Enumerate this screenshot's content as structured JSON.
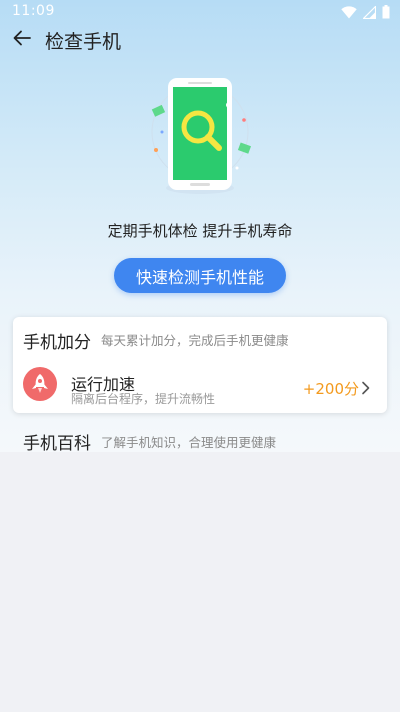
{
  "status_bar": {
    "time": "11:09",
    "icons": [
      "wifi-icon",
      "signal-icon",
      "battery-icon"
    ]
  },
  "app_bar": {
    "title": "检查手机",
    "back_icon": "arrow-left-icon"
  },
  "hero": {
    "tagline": "定期手机体检 提升手机寿命",
    "scan_button_label": "快速检测手机性能",
    "illustration_icon": "phone-magnifier-icon"
  },
  "score_card": {
    "title": "手机加分",
    "subtitle": "每天累计加分，完成后手机更健康",
    "tasks": [
      {
        "title": "运行加速",
        "subtitle": "隔离后台程序，提升流畅性",
        "reward": "+200分",
        "icon": "rocket-icon"
      }
    ]
  },
  "knowledge": {
    "title": "手机百科",
    "subtitle": "了解手机知识，合理使用更健康"
  },
  "colors": {
    "primary_button": "#3f86f0",
    "reward_text": "#f39a1e",
    "task_icon_bg": "#f06a6a",
    "phone_screen": "#2bcb6e",
    "background": "#f0f1f5"
  }
}
